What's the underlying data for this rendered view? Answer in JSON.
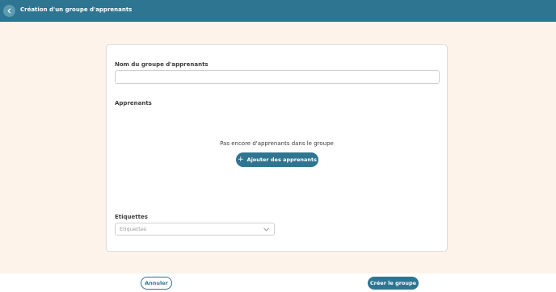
{
  "header": {
    "title": "Création d'un groupe d'apprenants",
    "back_icon": "chevron-left-icon"
  },
  "form": {
    "group_name_label": "Nom du groupe d'apprenants",
    "group_name_value": "",
    "learners_label": "Apprenants",
    "learners_empty_text": "Pas encore d'apprenants dans le groupe",
    "add_learners_label": "Ajouter des apprenants",
    "add_icon": "plus-icon",
    "tags_label": "Etiquettes",
    "tags_placeholder": "Etiquettes",
    "tags_icon": "chevron-down-icon"
  },
  "footer": {
    "cancel_label": "Annuler",
    "create_label": "Créer le groupe"
  },
  "colors": {
    "primary": "#2e7591",
    "background": "#fdf3eb"
  }
}
